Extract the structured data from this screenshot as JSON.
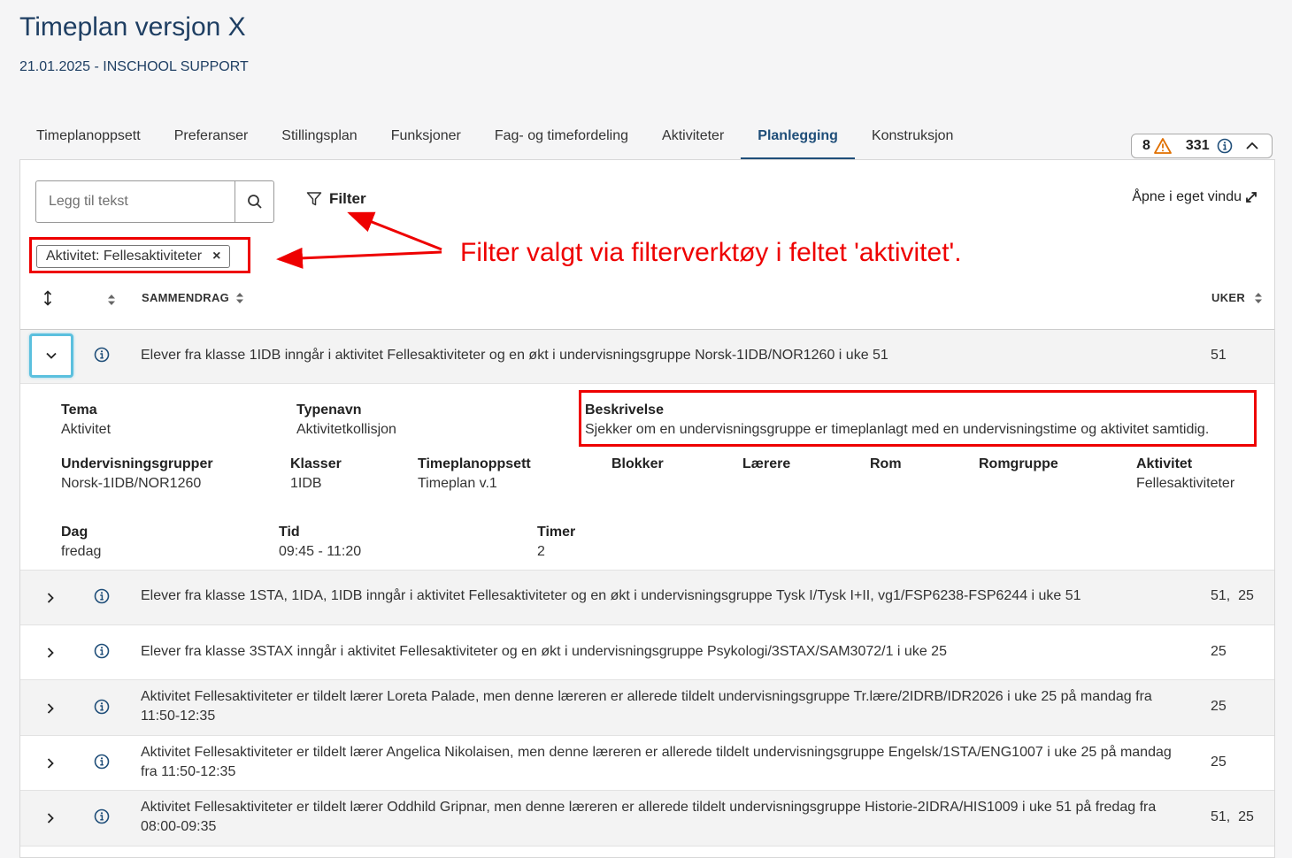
{
  "header": {
    "title": "Timeplan versjon X",
    "subtitle": "21.01.2025 - INSCHOOL SUPPORT"
  },
  "tabs": [
    {
      "label": "Timeplanoppsett"
    },
    {
      "label": "Preferanser"
    },
    {
      "label": "Stillingsplan"
    },
    {
      "label": "Funksjoner"
    },
    {
      "label": "Fag- og timefordeling"
    },
    {
      "label": "Aktiviteter"
    },
    {
      "label": "Planlegging",
      "active": true
    },
    {
      "label": "Konstruksjon"
    }
  ],
  "status": {
    "warnings": "8",
    "infos": "331"
  },
  "toolbar": {
    "search_placeholder": "Legg til tekst",
    "filter_label": "Filter",
    "open_window_label": "Åpne i eget vindu"
  },
  "active_filter": {
    "label": "Aktivitet: Fellesaktiviteter",
    "remove": "×"
  },
  "annotation": "Filter valgt via filterverktøy i feltet 'aktivitet'.",
  "table": {
    "col_summary": "SAMMENDRAG",
    "col_weeks": "UKER",
    "rows": [
      {
        "summary": "Elever fra klasse 1IDB inngår i aktivitet Fellesaktiviteter og en økt i undervisningsgruppe Norsk-1IDB/NOR1260 i uke 51",
        "weeks": "51"
      },
      {
        "summary": "Elever fra klasse 1STA, 1IDA, 1IDB inngår i aktivitet Fellesaktiviteter og en økt i undervisningsgruppe Tysk I/Tysk I+II, vg1/FSP6238-FSP6244 i uke 51",
        "weeks": "51,  25"
      },
      {
        "summary": "Elever fra klasse 3STAX inngår i aktivitet Fellesaktiviteter og en økt i undervisningsgruppe Psykologi/3STAX/SAM3072/1 i uke 25",
        "weeks": "25"
      },
      {
        "summary": "Aktivitet Fellesaktiviteter er tildelt lærer Loreta Palade, men denne læreren er allerede tildelt undervisningsgruppe Tr.lære/2IDRB/IDR2026 i uke 25 på mandag fra 11:50-12:35",
        "weeks": "25"
      },
      {
        "summary": "Aktivitet Fellesaktiviteter er tildelt lærer Angelica Nikolaisen, men denne læreren er allerede tildelt undervisningsgruppe Engelsk/1STA/ENG1007 i uke 25 på mandag fra 11:50-12:35",
        "weeks": "25"
      },
      {
        "summary": "Aktivitet Fellesaktiviteter er tildelt lærer Oddhild Gripnar, men denne læreren er allerede tildelt undervisningsgruppe Historie-2IDRA/HIS1009 i uke 51 på fredag fra 08:00-09:35",
        "weeks": "51,  25"
      }
    ]
  },
  "details": {
    "tema": {
      "label": "Tema",
      "value": "Aktivitet"
    },
    "typenavn": {
      "label": "Typenavn",
      "value": "Aktivitetkollisjon"
    },
    "beskrivelse": {
      "label": "Beskrivelse",
      "value": "Sjekker om en undervisningsgruppe er timeplanlagt med en undervisningstime og aktivitet samtidig."
    },
    "undervisningsgrupper": {
      "label": "Undervisningsgrupper",
      "value": "Norsk-1IDB/NOR1260"
    },
    "klasser": {
      "label": "Klasser",
      "value": "1IDB"
    },
    "timeplanoppsett": {
      "label": "Timeplanoppsett",
      "value": "Timeplan v.1"
    },
    "blokker": {
      "label": "Blokker",
      "value": ""
    },
    "laerere": {
      "label": "Lærere",
      "value": ""
    },
    "rom": {
      "label": "Rom",
      "value": ""
    },
    "romgruppe": {
      "label": "Romgruppe",
      "value": ""
    },
    "aktivitet": {
      "label": "Aktivitet",
      "value": "Fellesaktiviteter"
    },
    "dag": {
      "label": "Dag",
      "value": "fredag"
    },
    "tid": {
      "label": "Tid",
      "value": "09:45 - 11:20"
    },
    "timer": {
      "label": "Timer",
      "value": "2"
    }
  },
  "colors": {
    "brand": "#1f3f63",
    "annotation": "#ee0000",
    "focus": "#5bc0de",
    "warning": "#e07000"
  }
}
